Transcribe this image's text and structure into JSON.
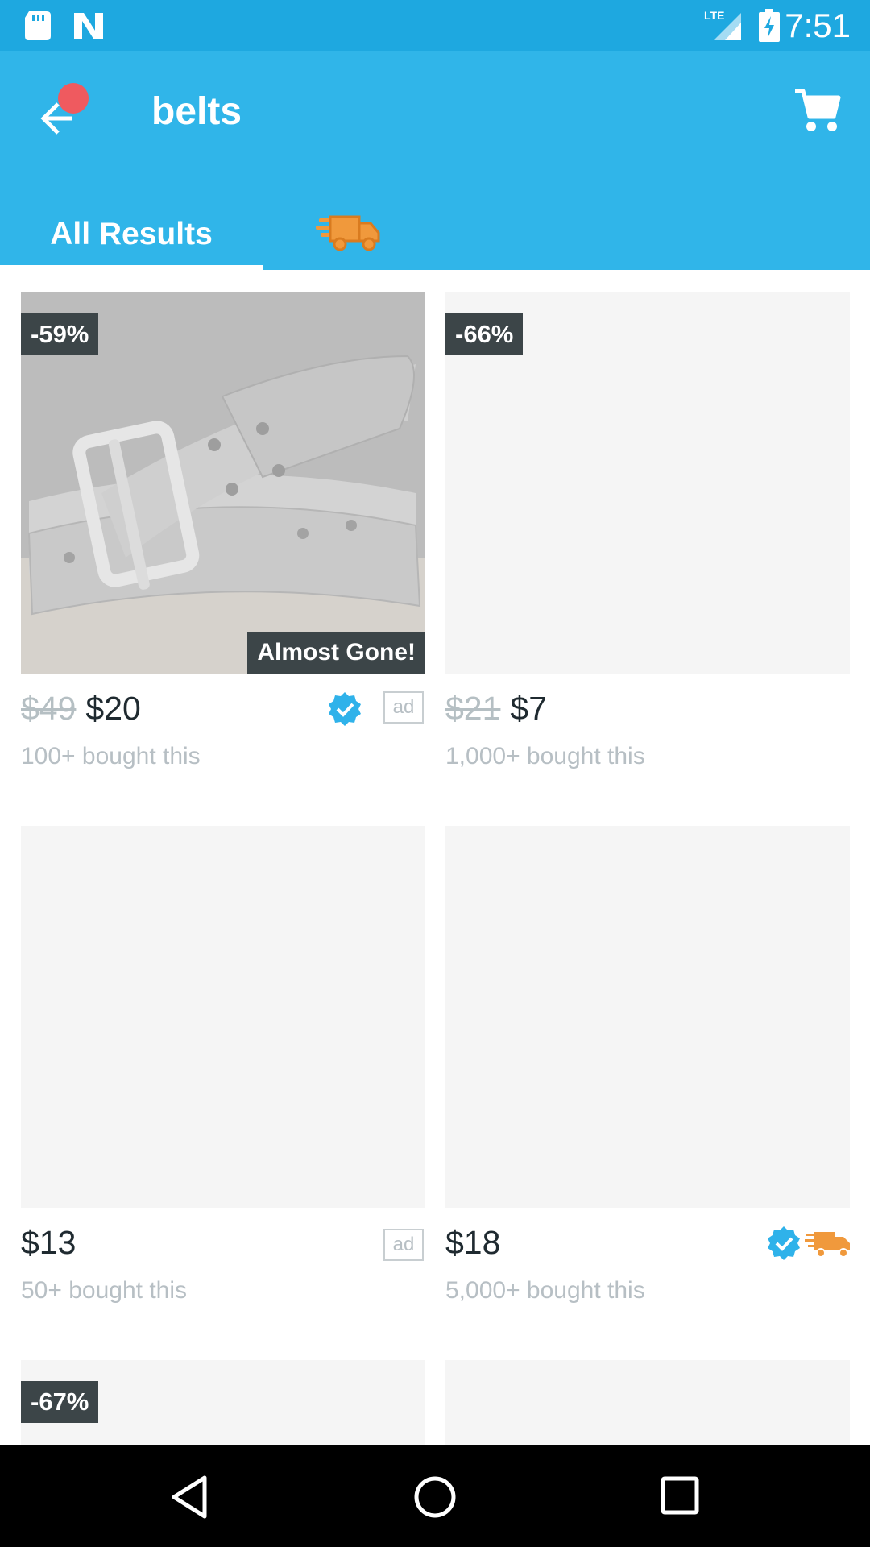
{
  "status_bar": {
    "time": "7:51",
    "icons": [
      "sd-card-icon",
      "n-notification-icon",
      "lte-signal-icon",
      "battery-charging-icon"
    ]
  },
  "app_bar": {
    "search_query": "belts",
    "back_icon": "arrow-left-icon",
    "cart_icon": "shopping-cart-icon"
  },
  "tabs": [
    {
      "label": "All Results",
      "selected": true
    },
    {
      "label": "",
      "icon": "express-truck-icon",
      "selected": false
    }
  ],
  "products": [
    {
      "discount": "-59%",
      "badge": "Almost Gone!",
      "old_price": "$49",
      "price": "$20",
      "bought": "100+ bought this",
      "verified": true,
      "ad": "ad"
    },
    {
      "discount": "-66%",
      "old_price": "$21",
      "price": "$7",
      "bought": "1,000+ bought this"
    },
    {
      "price": "$13",
      "bought": "50+ bought this",
      "ad": "ad"
    },
    {
      "price": "$18",
      "bought": "5,000+ bought this",
      "verified": true,
      "express": true
    },
    {
      "discount": "-67%"
    },
    {}
  ],
  "colors": {
    "status_bar": "#1ea8e0",
    "app_bar": "#30b5e9",
    "badge_bg": "#3c4548",
    "verified": "#2fb2ea",
    "express": "#f0993c",
    "notification_dot": "#ef5a5f"
  },
  "nav_bar": {
    "icons": [
      "back-triangle-icon",
      "home-circle-icon",
      "recents-square-icon"
    ]
  }
}
